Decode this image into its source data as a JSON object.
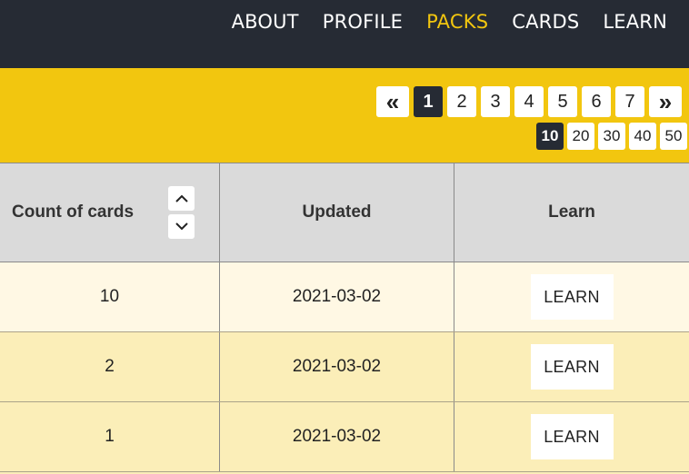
{
  "nav": {
    "items": [
      {
        "label": "ABOUT",
        "active": false
      },
      {
        "label": "PROFILE",
        "active": false
      },
      {
        "label": "PACKS",
        "active": true
      },
      {
        "label": "CARDS",
        "active": false
      },
      {
        "label": "LEARN",
        "active": false
      }
    ]
  },
  "pagination": {
    "prev_label": "«",
    "next_label": "»",
    "pages": [
      "1",
      "2",
      "3",
      "4",
      "5",
      "6",
      "7"
    ],
    "current_page": "1"
  },
  "page_size": {
    "options": [
      "10",
      "20",
      "30",
      "40",
      "50"
    ],
    "selected": "10"
  },
  "table": {
    "columns": [
      "Count of cards",
      "Updated",
      "Learn"
    ],
    "rows": [
      {
        "count": "10",
        "updated": "2021-03-02",
        "action": "LEARN"
      },
      {
        "count": "2",
        "updated": "2021-03-02",
        "action": "LEARN"
      },
      {
        "count": "1",
        "updated": "2021-03-02",
        "action": "LEARN"
      }
    ]
  },
  "icons": {
    "sort_up": "chevron-up-icon",
    "sort_down": "chevron-down-icon"
  },
  "colors": {
    "nav_bg": "#262b34",
    "accent": "#f2c60f",
    "header_bg": "#dadada",
    "row_light": "#fff8e4",
    "row_yellow": "#fbeeb8"
  }
}
